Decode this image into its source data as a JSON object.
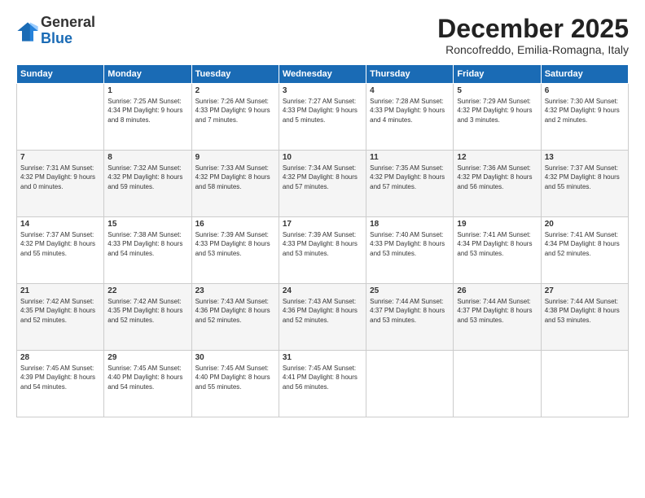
{
  "logo": {
    "line1": "General",
    "line2": "Blue"
  },
  "title": "December 2025",
  "subtitle": "Roncofreddo, Emilia-Romagna, Italy",
  "days": [
    "Sunday",
    "Monday",
    "Tuesday",
    "Wednesday",
    "Thursday",
    "Friday",
    "Saturday"
  ],
  "weeks": [
    [
      {
        "day": "",
        "content": ""
      },
      {
        "day": "1",
        "content": "Sunrise: 7:25 AM\nSunset: 4:34 PM\nDaylight: 9 hours\nand 8 minutes."
      },
      {
        "day": "2",
        "content": "Sunrise: 7:26 AM\nSunset: 4:33 PM\nDaylight: 9 hours\nand 7 minutes."
      },
      {
        "day": "3",
        "content": "Sunrise: 7:27 AM\nSunset: 4:33 PM\nDaylight: 9 hours\nand 5 minutes."
      },
      {
        "day": "4",
        "content": "Sunrise: 7:28 AM\nSunset: 4:33 PM\nDaylight: 9 hours\nand 4 minutes."
      },
      {
        "day": "5",
        "content": "Sunrise: 7:29 AM\nSunset: 4:32 PM\nDaylight: 9 hours\nand 3 minutes."
      },
      {
        "day": "6",
        "content": "Sunrise: 7:30 AM\nSunset: 4:32 PM\nDaylight: 9 hours\nand 2 minutes."
      }
    ],
    [
      {
        "day": "7",
        "content": "Sunrise: 7:31 AM\nSunset: 4:32 PM\nDaylight: 9 hours\nand 0 minutes."
      },
      {
        "day": "8",
        "content": "Sunrise: 7:32 AM\nSunset: 4:32 PM\nDaylight: 8 hours\nand 59 minutes."
      },
      {
        "day": "9",
        "content": "Sunrise: 7:33 AM\nSunset: 4:32 PM\nDaylight: 8 hours\nand 58 minutes."
      },
      {
        "day": "10",
        "content": "Sunrise: 7:34 AM\nSunset: 4:32 PM\nDaylight: 8 hours\nand 57 minutes."
      },
      {
        "day": "11",
        "content": "Sunrise: 7:35 AM\nSunset: 4:32 PM\nDaylight: 8 hours\nand 57 minutes."
      },
      {
        "day": "12",
        "content": "Sunrise: 7:36 AM\nSunset: 4:32 PM\nDaylight: 8 hours\nand 56 minutes."
      },
      {
        "day": "13",
        "content": "Sunrise: 7:37 AM\nSunset: 4:32 PM\nDaylight: 8 hours\nand 55 minutes."
      }
    ],
    [
      {
        "day": "14",
        "content": "Sunrise: 7:37 AM\nSunset: 4:32 PM\nDaylight: 8 hours\nand 55 minutes."
      },
      {
        "day": "15",
        "content": "Sunrise: 7:38 AM\nSunset: 4:33 PM\nDaylight: 8 hours\nand 54 minutes."
      },
      {
        "day": "16",
        "content": "Sunrise: 7:39 AM\nSunset: 4:33 PM\nDaylight: 8 hours\nand 53 minutes."
      },
      {
        "day": "17",
        "content": "Sunrise: 7:39 AM\nSunset: 4:33 PM\nDaylight: 8 hours\nand 53 minutes."
      },
      {
        "day": "18",
        "content": "Sunrise: 7:40 AM\nSunset: 4:33 PM\nDaylight: 8 hours\nand 53 minutes."
      },
      {
        "day": "19",
        "content": "Sunrise: 7:41 AM\nSunset: 4:34 PM\nDaylight: 8 hours\nand 53 minutes."
      },
      {
        "day": "20",
        "content": "Sunrise: 7:41 AM\nSunset: 4:34 PM\nDaylight: 8 hours\nand 52 minutes."
      }
    ],
    [
      {
        "day": "21",
        "content": "Sunrise: 7:42 AM\nSunset: 4:35 PM\nDaylight: 8 hours\nand 52 minutes."
      },
      {
        "day": "22",
        "content": "Sunrise: 7:42 AM\nSunset: 4:35 PM\nDaylight: 8 hours\nand 52 minutes."
      },
      {
        "day": "23",
        "content": "Sunrise: 7:43 AM\nSunset: 4:36 PM\nDaylight: 8 hours\nand 52 minutes."
      },
      {
        "day": "24",
        "content": "Sunrise: 7:43 AM\nSunset: 4:36 PM\nDaylight: 8 hours\nand 52 minutes."
      },
      {
        "day": "25",
        "content": "Sunrise: 7:44 AM\nSunset: 4:37 PM\nDaylight: 8 hours\nand 53 minutes."
      },
      {
        "day": "26",
        "content": "Sunrise: 7:44 AM\nSunset: 4:37 PM\nDaylight: 8 hours\nand 53 minutes."
      },
      {
        "day": "27",
        "content": "Sunrise: 7:44 AM\nSunset: 4:38 PM\nDaylight: 8 hours\nand 53 minutes."
      }
    ],
    [
      {
        "day": "28",
        "content": "Sunrise: 7:45 AM\nSunset: 4:39 PM\nDaylight: 8 hours\nand 54 minutes."
      },
      {
        "day": "29",
        "content": "Sunrise: 7:45 AM\nSunset: 4:40 PM\nDaylight: 8 hours\nand 54 minutes."
      },
      {
        "day": "30",
        "content": "Sunrise: 7:45 AM\nSunset: 4:40 PM\nDaylight: 8 hours\nand 55 minutes."
      },
      {
        "day": "31",
        "content": "Sunrise: 7:45 AM\nSunset: 4:41 PM\nDaylight: 8 hours\nand 56 minutes."
      },
      {
        "day": "",
        "content": ""
      },
      {
        "day": "",
        "content": ""
      },
      {
        "day": "",
        "content": ""
      }
    ]
  ]
}
